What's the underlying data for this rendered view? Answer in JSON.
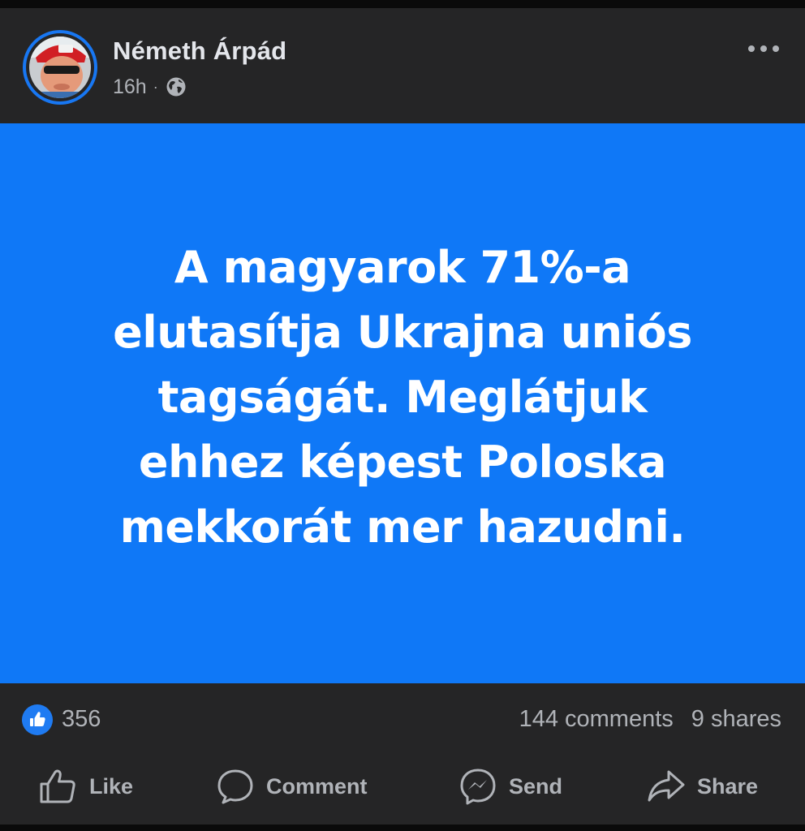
{
  "post": {
    "author": "Németh Árpád",
    "time": "16h",
    "separator": "·",
    "audience_icon": "globe-icon",
    "more_icon": "ellipsis-icon",
    "text_lines": [
      "A magyarok 71%-a",
      "elutasítja Ukrajna uniós",
      "tagságát. Meglátjuk",
      "ehhez képest Poloska",
      "mekkorát mer hazudni."
    ],
    "background_color": "#0f78f7"
  },
  "reactions": {
    "icon": "thumbs-up-icon",
    "count": "356",
    "comments": "144 comments",
    "shares": "9 shares"
  },
  "actions": [
    {
      "label": "Like",
      "icon": "thumbs-up-outline-icon"
    },
    {
      "label": "Comment",
      "icon": "comment-bubble-icon"
    },
    {
      "label": "Send",
      "icon": "messenger-icon"
    },
    {
      "label": "Share",
      "icon": "share-arrow-icon"
    }
  ],
  "colors": {
    "card_background": "#252526",
    "accent": "#1877f2",
    "primary_text": "#e4e6eb",
    "secondary_text": "#b0b3b8"
  }
}
